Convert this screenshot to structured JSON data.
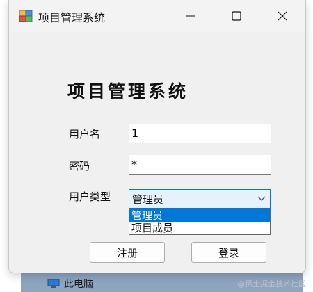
{
  "window": {
    "title": "项目管理系统"
  },
  "form": {
    "heading": "项目管理系统",
    "username_label": "用户名",
    "username_value": "1",
    "password_label": "密码",
    "password_value": "*",
    "usertype_label": "用户类型",
    "usertype_selected": "管理员",
    "usertype_options": [
      "管理员",
      "项目成员"
    ],
    "register_button": "注册",
    "login_button": "登录"
  },
  "desktop": {
    "item_label": "此电脑"
  },
  "watermark": "@稀土掘金技术社区",
  "colors": {
    "accent": "#0078d7",
    "window_bg": "#f0f0f0"
  }
}
